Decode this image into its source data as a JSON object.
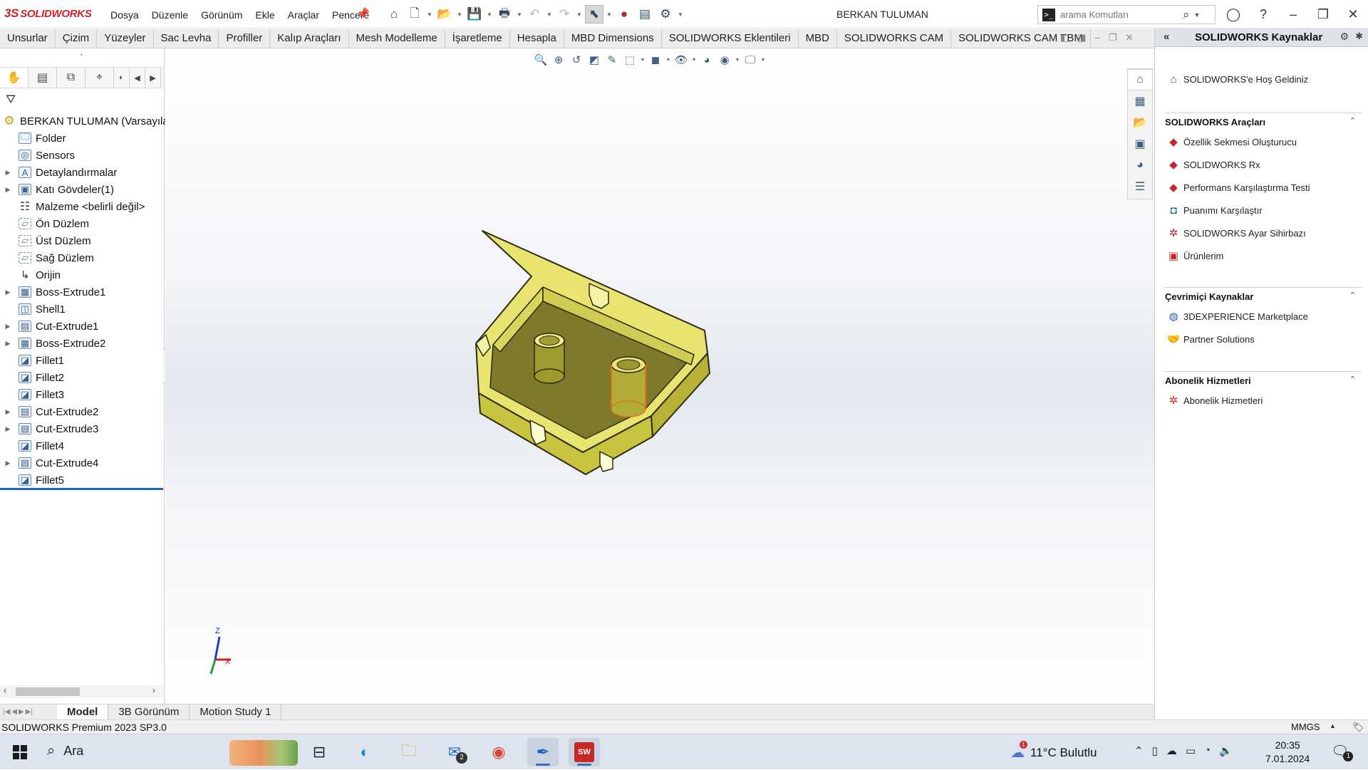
{
  "app": {
    "logo_prefix": "3S",
    "logo_text": "SOLIDWORKS",
    "doc_title": "BERKAN TULUMAN"
  },
  "menu": [
    "Dosya",
    "Düzenle",
    "Görünüm",
    "Ekle",
    "Araçlar",
    "Pencere"
  ],
  "search": {
    "placeholder": "arama Komutları"
  },
  "cm_tabs": [
    "Unsurlar",
    "Çizim",
    "Yüzeyler",
    "Sac Levha",
    "Profiller",
    "Kalıp Araçları",
    "Mesh Modelleme",
    "İşaretleme",
    "Hesapla",
    "MBD Dimensions",
    "SOLIDWORKS Eklentileri",
    "MBD",
    "SOLIDWORKS CAM",
    "SOLIDWORKS CAM TBM"
  ],
  "tree": {
    "root": "BERKAN TULUMAN (Varsayılan)",
    "items": [
      {
        "label": "Folder",
        "expandable": false,
        "icon": "folder-icon"
      },
      {
        "label": "Sensors",
        "expandable": false,
        "icon": "sensor-icon"
      },
      {
        "label": "Detaylandırmalar",
        "expandable": true,
        "icon": "annotation-icon"
      },
      {
        "label": "Katı Gövdeler(1)",
        "expandable": true,
        "icon": "solid-bodies-icon"
      },
      {
        "label": "Malzeme <belirli değil>",
        "expandable": false,
        "icon": "material-icon"
      },
      {
        "label": "Ön Düzlem",
        "expandable": false,
        "icon": "plane-icon"
      },
      {
        "label": "Üst Düzlem",
        "expandable": false,
        "icon": "plane-icon"
      },
      {
        "label": "Sağ Düzlem",
        "expandable": false,
        "icon": "plane-icon"
      },
      {
        "label": "Orijin",
        "expandable": false,
        "icon": "origin-icon"
      },
      {
        "label": "Boss-Extrude1",
        "expandable": true,
        "icon": "extrude-icon"
      },
      {
        "label": "Shell1",
        "expandable": false,
        "icon": "shell-icon"
      },
      {
        "label": "Cut-Extrude1",
        "expandable": true,
        "icon": "cut-extrude-icon"
      },
      {
        "label": "Boss-Extrude2",
        "expandable": true,
        "icon": "extrude-icon"
      },
      {
        "label": "Fillet1",
        "expandable": false,
        "icon": "fillet-icon"
      },
      {
        "label": "Fillet2",
        "expandable": false,
        "icon": "fillet-icon"
      },
      {
        "label": "Fillet3",
        "expandable": false,
        "icon": "fillet-icon"
      },
      {
        "label": "Cut-Extrude2",
        "expandable": true,
        "icon": "cut-extrude-icon"
      },
      {
        "label": "Cut-Extrude3",
        "expandable": true,
        "icon": "cut-extrude-icon"
      },
      {
        "label": "Fillet4",
        "expandable": false,
        "icon": "fillet-icon"
      },
      {
        "label": "Cut-Extrude4",
        "expandable": true,
        "icon": "cut-extrude-icon"
      },
      {
        "label": "Fillet5",
        "expandable": false,
        "icon": "fillet-icon"
      }
    ]
  },
  "triad": {
    "x": "X",
    "z": "Z"
  },
  "resources": {
    "title": "SOLIDWORKS Kaynaklar",
    "welcome": "SOLIDWORKS'e Hoş Geldiniz",
    "tools_title": "SOLIDWORKS Araçları",
    "tools": [
      "Özellik Sekmesi Oluşturucu",
      "SOLIDWORKS Rx",
      "Performans Karşılaştırma Testi",
      "Puanımı Karşılaştır",
      "SOLIDWORKS Ayar Sihirbazı",
      "Ürünlerim"
    ],
    "online_title": "Çevrimiçi Kaynaklar",
    "online": [
      "3DEXPERIENCE Marketplace",
      "Partner Solutions"
    ],
    "sub_title": "Abonelik Hizmetleri",
    "sub": [
      "Abonelik Hizmetleri"
    ]
  },
  "bottom_tabs": [
    "Model",
    "3B Görünüm",
    "Motion Study 1"
  ],
  "status": {
    "version": "SOLIDWORKS Premium 2023 SP3.0",
    "units": "MMGS"
  },
  "taskbar": {
    "search": "Ara",
    "weather": "11°C  Bulutlu",
    "weather_badge": "1",
    "mail_badge": "2",
    "time": "20:35",
    "date": "7.01.2024",
    "notif": "1"
  },
  "colors": {
    "part_yellow": "#e6e26a",
    "part_edge": "#2b2a10",
    "selection": "#e0731f",
    "brand_red": "#d31f26"
  }
}
